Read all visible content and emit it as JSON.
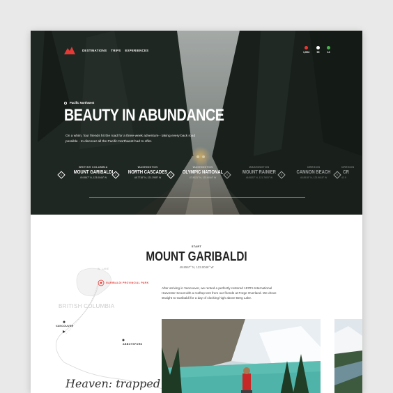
{
  "colors": {
    "accent": "#e53935",
    "stat_heart": "#e53935",
    "stat_chat": "#ffffff",
    "stat_share": "#4caf50"
  },
  "nav": {
    "links": [
      "DESTINATIONS",
      "TRIPS",
      "EXPERIENCES"
    ],
    "stats": [
      {
        "icon": "heart-icon",
        "value": "1,004"
      },
      {
        "icon": "comment-icon",
        "value": "95"
      },
      {
        "icon": "share-icon",
        "value": "14"
      }
    ]
  },
  "hero": {
    "region": "Pacific Northwest",
    "title": "BEAUTY IN ABUNDANCE",
    "description": "On a whim, four friends hit the road for a three-week adventure - taking every back road possible - to discover all the Pacific Northwest had to offer.",
    "progress": 0.3,
    "stops": [
      {
        "num": "1",
        "sub": "BRITISH COLUMBIA",
        "name": "MOUNT GARIBALDI",
        "coord": "49.8567° N, 123.0046° W"
      },
      {
        "num": "2",
        "sub": "WASHINGTON",
        "name": "NORTH CASCADES",
        "coord": "48.7718° N, 121.2985° W"
      },
      {
        "num": "3",
        "sub": "WASHINGTON",
        "name": "OLYMPIC NATIONAL",
        "coord": "47.8021° N, 123.6044° W"
      },
      {
        "num": "4",
        "sub": "WASHINGTON",
        "name": "MOUNT RAINIER",
        "coord": "46.8523° N, 121.7603° W"
      },
      {
        "num": "5",
        "sub": "OREGON",
        "name": "CANNON BEACH",
        "coord": "45.8918° N, 123.9615° W"
      },
      {
        "num": "6",
        "sub": "OREGON",
        "name": "CR",
        "coord": "42.9"
      }
    ]
  },
  "section": {
    "label": "START",
    "title": "MOUNT GARIBALDI",
    "coord": "49.8567° N, 123.0046° W",
    "intro": "After arriving in Vancouver, we rented a perfectly restored 1970's International Harvester Scout with a rooftop tent from our friends at Forge Overland. We drove straight to Garibaldi for a day of clocking high above Berg Lake.",
    "quote": "Heaven: trapped"
  },
  "map": {
    "labels": {
      "start": "GARIBALDI PROVINCIAL PARK",
      "province": "BRITISH COLUMBIA",
      "city1": "VANCOUVER",
      "city2": "ABBOTSFORD",
      "top": "W. LAKE"
    }
  }
}
